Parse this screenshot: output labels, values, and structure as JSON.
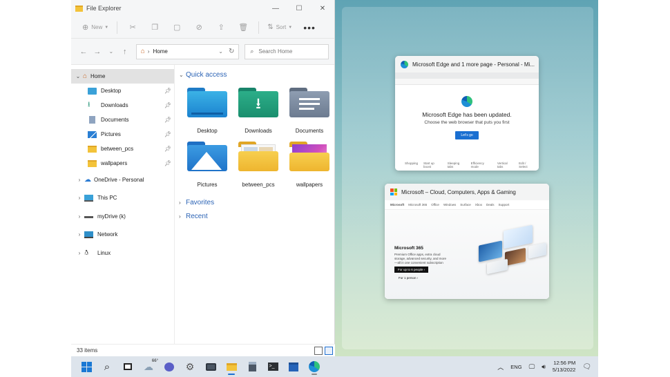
{
  "explorer": {
    "title": "File Explorer",
    "window_controls": {
      "minimize": "—",
      "maximize": "☐",
      "close": "✕"
    },
    "toolbar": {
      "new_label": "New",
      "sort_label": "Sort",
      "more_label": "•••"
    },
    "address": {
      "crumb": "Home"
    },
    "search": {
      "placeholder": "Search Home"
    },
    "nav": {
      "home": "Home",
      "quick": [
        "Desktop",
        "Downloads",
        "Documents",
        "Pictures",
        "between_pcs",
        "wallpapers"
      ],
      "onedrive": "OneDrive - Personal",
      "thispc": "This PC",
      "mydrive": "myDrive (k)",
      "network": "Network",
      "linux": "Linux"
    },
    "groups": {
      "quick_access": "Quick access",
      "favorites": "Favorites",
      "recent": "Recent"
    },
    "tiles": [
      "Desktop",
      "Downloads",
      "Documents",
      "Pictures",
      "between_pcs",
      "wallpapers"
    ],
    "status": {
      "items": "33 items"
    }
  },
  "snap": {
    "edge_window": {
      "title": "Microsoft Edge and 1 more page - Personal - Mi...",
      "heading": "Microsoft Edge has been updated.",
      "subtitle": "Choose the web browser that puts you first",
      "button": "Let's go",
      "footer": [
        "Shopping",
        "Start up boost",
        "Sleeping tabs",
        "Efficiency mode",
        "Vertical tabs",
        "Edit / Select"
      ]
    },
    "ms_window": {
      "title": "Microsoft – Cloud, Computers, Apps & Gaming",
      "nav": [
        "Microsoft",
        "Microsoft 365",
        "Office",
        "Windows",
        "Surface",
        "Xbox",
        "Deals",
        "Support"
      ],
      "heading": "Microsoft 365",
      "text": "Premium Office apps, extra cloud storage, advanced security, and more—all in one convenient subscription",
      "cta": "For up to 6 people ›",
      "cta2": "For 1 person ›"
    }
  },
  "taskbar": {
    "weather_temp": "66°",
    "lang": "ENG",
    "time": "12:56 PM",
    "date": "5/13/2022"
  },
  "colors": {
    "accent": "#1a6fd1",
    "folder": "#f3c33a",
    "link": "#2b63b5"
  }
}
